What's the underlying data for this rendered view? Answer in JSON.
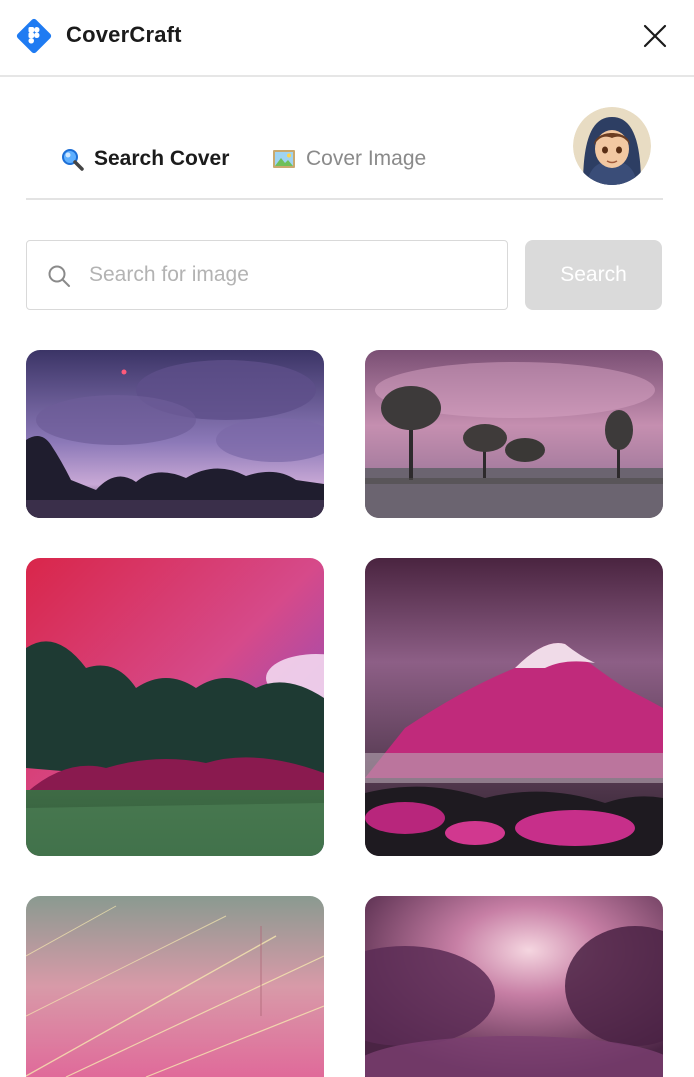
{
  "app": {
    "title": "CoverCraft",
    "logo_icon": "figma-logo-icon",
    "brand_color": "#1f7bf2"
  },
  "header": {
    "close_icon": "close-icon"
  },
  "tabs": [
    {
      "label": "Search Cover",
      "icon": "magnifier-emoji-icon",
      "active": true
    },
    {
      "label": "Cover Image",
      "icon": "framed-picture-emoji-icon",
      "active": false
    }
  ],
  "search": {
    "placeholder": "Search for image",
    "value": "",
    "button_label": "Search",
    "button_color": "#dadada"
  },
  "results": [
    {
      "name": "purple-night-forest"
    },
    {
      "name": "pink-sky-savanna"
    },
    {
      "name": "magenta-forest-meadow"
    },
    {
      "name": "pink-mountain-lake"
    },
    {
      "name": "pink-sky-streaks"
    },
    {
      "name": "purple-clouds-sky"
    }
  ]
}
